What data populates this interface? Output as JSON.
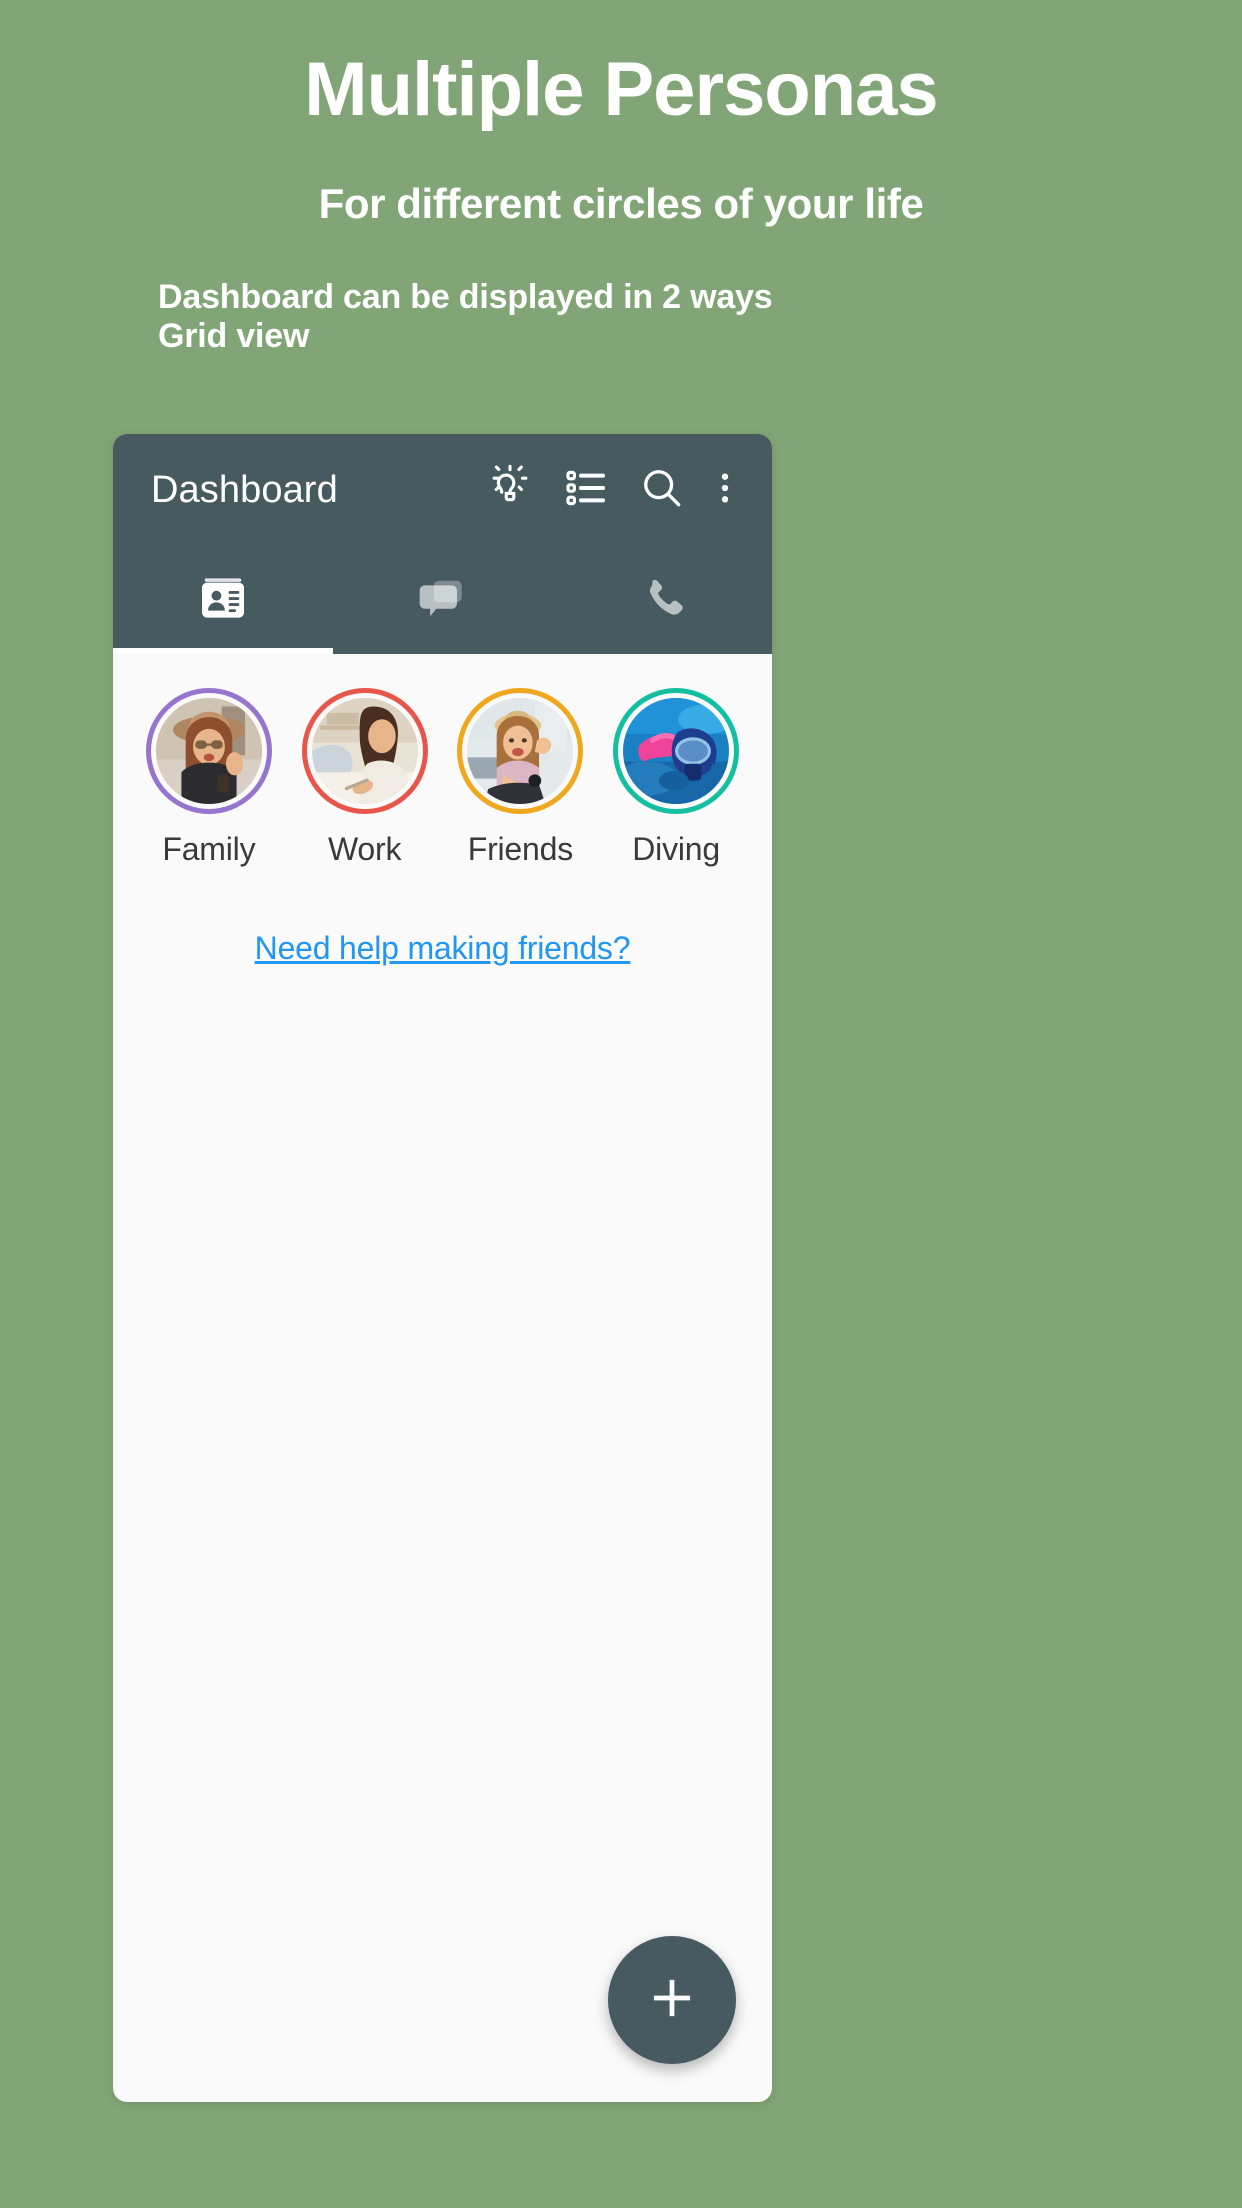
{
  "promo": {
    "title": "Multiple Personas",
    "subtitle": "For different circles of your life",
    "caption_line_1": "Dashboard can be displayed in 2 ways",
    "caption_line_2": "Grid view",
    "background_color": "#81a576",
    "text_color": "#ffffff"
  },
  "app": {
    "appbar": {
      "title": "Dashboard",
      "background_color": "#475a60",
      "actions": [
        {
          "name": "lightbulb-icon",
          "label": "Tips"
        },
        {
          "name": "list-view-icon",
          "label": "List view"
        },
        {
          "name": "search-icon",
          "label": "Search"
        },
        {
          "name": "overflow-menu-icon",
          "label": "More options"
        }
      ]
    },
    "tabs": [
      {
        "name": "contacts-tab",
        "icon": "contact-card-icon",
        "label": "Contacts",
        "active": true
      },
      {
        "name": "messages-tab",
        "icon": "chat-bubbles-icon",
        "label": "Messages",
        "active": false
      },
      {
        "name": "calls-tab",
        "icon": "phone-icon",
        "label": "Calls",
        "active": false
      }
    ],
    "personas": [
      {
        "label": "Family",
        "ring_color": "#9575cd"
      },
      {
        "label": "Work",
        "ring_color": "#e8564b"
      },
      {
        "label": "Friends",
        "ring_color": "#efa81e"
      },
      {
        "label": "Diving",
        "ring_color": "#13bfa0"
      }
    ],
    "help_link": {
      "label": "Need help making friends?",
      "color": "#2196f3"
    },
    "fab": {
      "label": "+",
      "name": "add-persona-fab",
      "background_color": "#475a60"
    }
  }
}
